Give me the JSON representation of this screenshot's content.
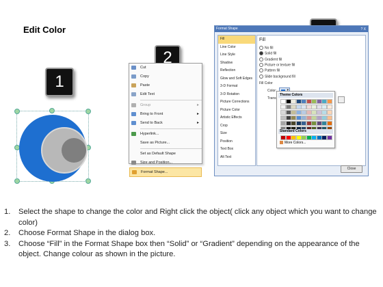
{
  "title": "Edit Color",
  "badges": [
    "1",
    "2",
    "3"
  ],
  "context_menu": {
    "items": [
      {
        "label": "Cut",
        "icon": "scissors-icon",
        "disabled": false,
        "submenu": false,
        "highlight": false
      },
      {
        "label": "Copy",
        "icon": "copy-icon",
        "disabled": false,
        "submenu": false,
        "highlight": false
      },
      {
        "label": "Paste",
        "icon": "paste-icon",
        "disabled": false,
        "submenu": false,
        "highlight": false
      },
      {
        "label": "Edit Text",
        "icon": "edit-text-icon",
        "disabled": false,
        "submenu": false,
        "highlight": false
      },
      {
        "label": "Group",
        "icon": "group-icon",
        "disabled": true,
        "submenu": true,
        "highlight": false
      },
      {
        "label": "Bring to Front",
        "icon": "bring-front-icon",
        "disabled": false,
        "submenu": true,
        "highlight": false
      },
      {
        "label": "Send to Back",
        "icon": "send-back-icon",
        "disabled": false,
        "submenu": true,
        "highlight": false
      },
      {
        "label": "Hyperlink...",
        "icon": "hyperlink-icon",
        "disabled": false,
        "submenu": false,
        "highlight": false
      },
      {
        "label": "Save as Picture...",
        "icon": "",
        "disabled": false,
        "submenu": false,
        "highlight": false
      },
      {
        "label": "Set as Default Shape",
        "icon": "",
        "disabled": false,
        "submenu": false,
        "highlight": false
      },
      {
        "label": "Size and Position...",
        "icon": "size-icon",
        "disabled": false,
        "submenu": false,
        "highlight": false
      },
      {
        "label": "Format Shape...",
        "icon": "format-shape-icon",
        "disabled": false,
        "submenu": false,
        "highlight": true
      }
    ]
  },
  "dialog": {
    "title": "Format Shape",
    "title_buttons": "? X",
    "categories": [
      "Fill",
      "Line Color",
      "Line Style",
      "Shadow",
      "Reflection",
      "Glow and Soft Edges",
      "3-D Format",
      "3-D Rotation",
      "Picture Corrections",
      "Picture Color",
      "Artistic Effects",
      "Crop",
      "Size",
      "Position",
      "Text Box",
      "Alt Text"
    ],
    "selected_category": "Fill",
    "fill_heading": "Fill",
    "fill_options": [
      {
        "label": "No fill",
        "selected": false
      },
      {
        "label": "Solid fill",
        "selected": true
      },
      {
        "label": "Gradient fill",
        "selected": false
      },
      {
        "label": "Picture or texture fill",
        "selected": false
      },
      {
        "label": "Pattern fill",
        "selected": false
      },
      {
        "label": "Slide background fill",
        "selected": false
      }
    ],
    "fill_color_label": "Fill Color",
    "color_label": "Color:",
    "transparency_label": "Transpa",
    "close_label": "Close"
  },
  "palette": {
    "theme_label": "Theme Colors",
    "standard_label": "Standard Colors",
    "more_colors": "More Colors...",
    "theme_colors": [
      "#ffffff",
      "#000000",
      "#eeece1",
      "#1f497d",
      "#4f81bd",
      "#c0504d",
      "#9bbb59",
      "#8064a2",
      "#4bacc6",
      "#f79646",
      "#f2f2f2",
      "#7f7f7f",
      "#ddd9c3",
      "#c6d9f0",
      "#dbe5f1",
      "#f2dcdb",
      "#ebf1dd",
      "#e5e0ec",
      "#dbeef3",
      "#fdeada",
      "#d8d8d8",
      "#595959",
      "#c4bd97",
      "#8db3e2",
      "#b8cce4",
      "#e5b9b7",
      "#d7e3bc",
      "#ccc1d9",
      "#b7dde8",
      "#fbd5b5",
      "#bfbfbf",
      "#3f3f3f",
      "#938953",
      "#548dd4",
      "#95b3d7",
      "#d99694",
      "#c3d69b",
      "#b2a2c7",
      "#92cddc",
      "#fac08f",
      "#a5a5a5",
      "#262626",
      "#494429",
      "#17365d",
      "#366092",
      "#953734",
      "#76923c",
      "#5f497a",
      "#31859b",
      "#e36c09",
      "#7f7f7f",
      "#0c0c0c",
      "#1d1b10",
      "#0f243e",
      "#244061",
      "#632423",
      "#4f6128",
      "#3f3151",
      "#205867",
      "#974806"
    ],
    "standard_colors": [
      "#c00000",
      "#ff0000",
      "#ffc000",
      "#ffff00",
      "#92d050",
      "#00b050",
      "#00b0f0",
      "#0070c0",
      "#002060",
      "#7030a0"
    ]
  },
  "instructions": [
    {
      "num": "1.",
      "text": "Select the shape to change the color and Right click the object( click any object which you want to change color)"
    },
    {
      "num": "2.",
      "text": "Choose Format Shape in the dialog box."
    },
    {
      "num": "3.",
      "text": "Choose “Fill” in the Format Shape box then “Solid” or “Gradient” depending on the appearance of the object. Change colour as shown in the picture."
    }
  ]
}
